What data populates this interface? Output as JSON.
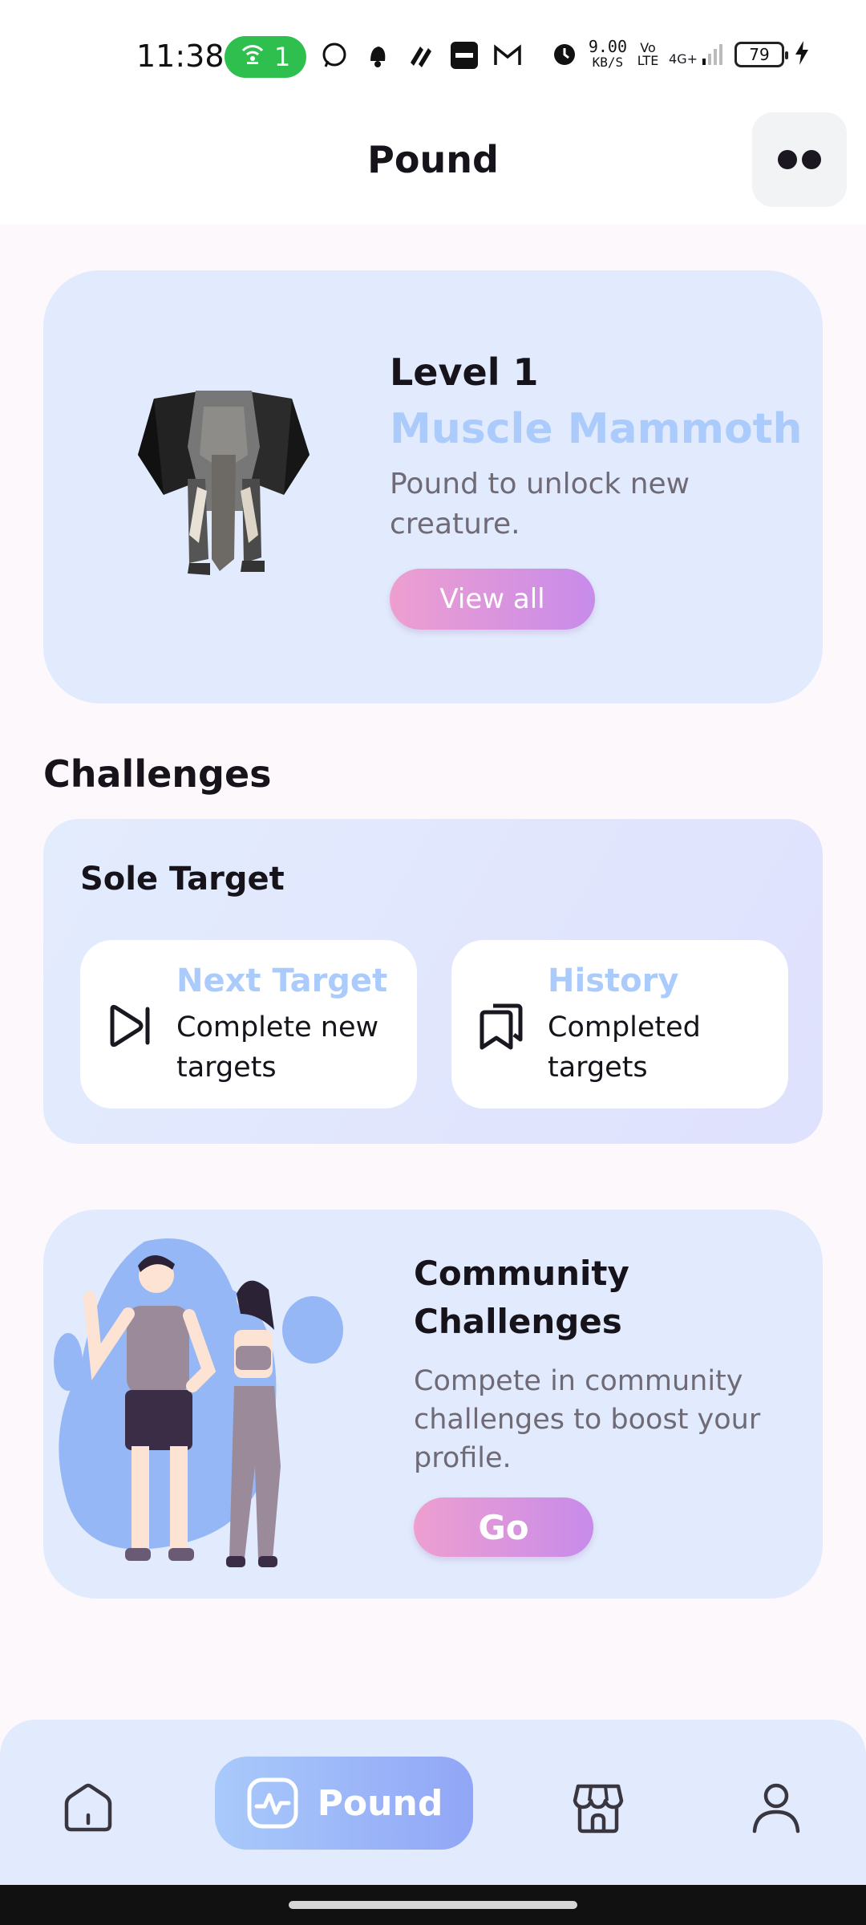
{
  "status_bar": {
    "time": "11:38",
    "hotspot_count": "1",
    "speed_value": "9.00",
    "speed_unit": "KB/S",
    "volte": "Vo LTE",
    "network": "4G+",
    "battery": "79",
    "icons": [
      "hotspot-icon",
      "whatsapp-icon",
      "notification-bell-icon",
      "app-icon",
      "paytm-icon",
      "gmail-icon",
      "alarm-icon",
      "signal-icon",
      "charging-icon"
    ]
  },
  "header": {
    "title": "Pound",
    "menu_icon": "dots-icon"
  },
  "level_card": {
    "level": "Level 1",
    "creature": "Muscle Mammoth",
    "description": "Pound to unlock new creature.",
    "button_label": "View all"
  },
  "challenges": {
    "heading": "Challenges",
    "sole_target": {
      "title": "Sole Target",
      "next": {
        "title": "Next Target",
        "description": "Complete new targets",
        "icon": "skip-forward-icon"
      },
      "history": {
        "title": "History",
        "description": "Completed targets",
        "icon": "bookmarks-icon"
      }
    }
  },
  "community": {
    "title": "Community Challenges",
    "description": "Compete in community challenges to boost your profile.",
    "button_label": "Go"
  },
  "bottom_nav": {
    "items": [
      {
        "icon": "home-icon"
      },
      {
        "label": "Pound",
        "icon": "activity-icon",
        "active": true
      },
      {
        "icon": "store-icon"
      },
      {
        "icon": "profile-icon"
      }
    ]
  },
  "colors": {
    "accent_blue": "#aacbfb",
    "card_bg": "#e2ebfd",
    "button_gradient_start": "#ee9fd0",
    "button_gradient_end": "#c78bea",
    "active_nav_start": "#a9cafb",
    "active_nav_end": "#91a6f6"
  }
}
